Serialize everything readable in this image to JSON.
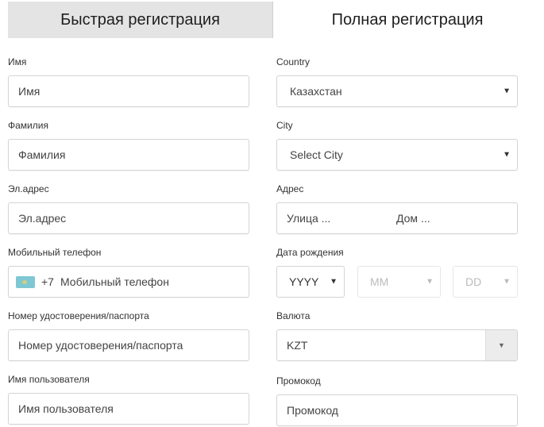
{
  "tabs": [
    {
      "label": "Быстрая регистрация",
      "active": true
    },
    {
      "label": "Полная регистрация",
      "active": false
    }
  ],
  "left_fields": {
    "first_name": {
      "label": "Имя",
      "placeholder": "Имя"
    },
    "last_name": {
      "label": "Фамилия",
      "placeholder": "Фамилия"
    },
    "email": {
      "label": "Эл.адрес",
      "placeholder": "Эл.адрес"
    },
    "phone": {
      "label": "Мобильный телефон",
      "country_code": "+7",
      "placeholder": "Мобильный телефон",
      "flag_icon": "kazakhstan-flag"
    },
    "passport": {
      "label": "Номер удостоверения/паспорта",
      "placeholder": "Номер удостоверения/паспорта"
    },
    "username": {
      "label": "Имя пользователя",
      "placeholder": "Имя пользователя"
    }
  },
  "right_fields": {
    "country": {
      "label": "Country",
      "value": "Казахстан",
      "caret": "▼"
    },
    "city": {
      "label": "City",
      "value": "Select City",
      "caret": "▼"
    },
    "address": {
      "label": "Адрес",
      "street_placeholder": "Улица ...",
      "house_placeholder": "Дом ..."
    },
    "birthdate": {
      "label": "Дата рождения",
      "year": "YYYY",
      "month": "MM",
      "day": "DD",
      "caret": "▼"
    },
    "currency": {
      "label": "Валюта",
      "value": "KZT",
      "caret": "▼"
    },
    "promo": {
      "label": "Промокод",
      "placeholder": "Промокод"
    }
  }
}
